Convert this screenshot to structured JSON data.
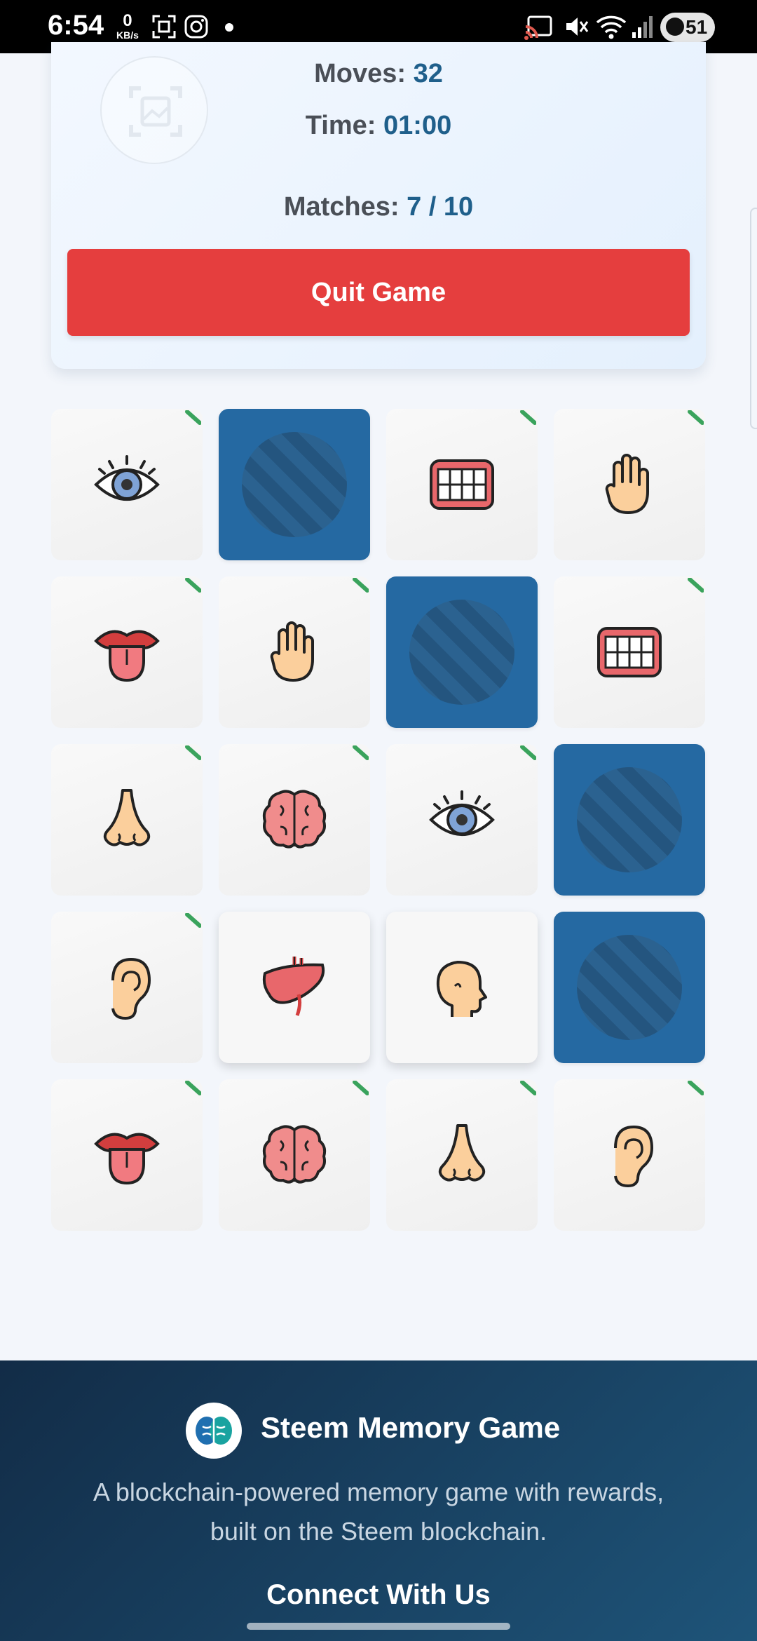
{
  "status_bar": {
    "time": "6:54",
    "net_speed_value": "0",
    "net_speed_unit": "KB/s",
    "battery": "51"
  },
  "stats": {
    "moves_label": "Moves:",
    "moves_value": "32",
    "time_label": "Time:",
    "time_value": "01:00",
    "matches_label": "Matches:",
    "matches_value": "7 / 10"
  },
  "quit_label": "Quit Game",
  "board": {
    "tiles": [
      {
        "icon": "eye-icon",
        "state": "matched"
      },
      {
        "icon": "card-back",
        "state": "hidden"
      },
      {
        "icon": "teeth-icon",
        "state": "matched"
      },
      {
        "icon": "hand-icon",
        "state": "matched"
      },
      {
        "icon": "tongue-icon",
        "state": "matched"
      },
      {
        "icon": "hand-icon",
        "state": "matched"
      },
      {
        "icon": "card-back",
        "state": "hidden"
      },
      {
        "icon": "teeth-icon",
        "state": "matched"
      },
      {
        "icon": "nose-icon",
        "state": "matched"
      },
      {
        "icon": "brain-icon",
        "state": "matched"
      },
      {
        "icon": "eye-icon",
        "state": "matched"
      },
      {
        "icon": "card-back",
        "state": "hidden"
      },
      {
        "icon": "ear-icon",
        "state": "matched"
      },
      {
        "icon": "liver-icon",
        "state": "flipped"
      },
      {
        "icon": "head-icon",
        "state": "flipped"
      },
      {
        "icon": "card-back",
        "state": "hidden"
      },
      {
        "icon": "tongue-icon",
        "state": "matched"
      },
      {
        "icon": "brain-icon",
        "state": "matched"
      },
      {
        "icon": "nose-icon",
        "state": "matched"
      },
      {
        "icon": "ear-icon",
        "state": "matched"
      }
    ]
  },
  "footer": {
    "title": "Steem Memory Game",
    "description": "A blockchain-powered memory game with rewards, built on the Steem blockchain.",
    "connect": "Connect With Us"
  },
  "colors": {
    "accent": "#1f5f8b",
    "quit": "#e53e3e",
    "card_back": "#2569a2",
    "matched_dot": "#3aa35c"
  }
}
